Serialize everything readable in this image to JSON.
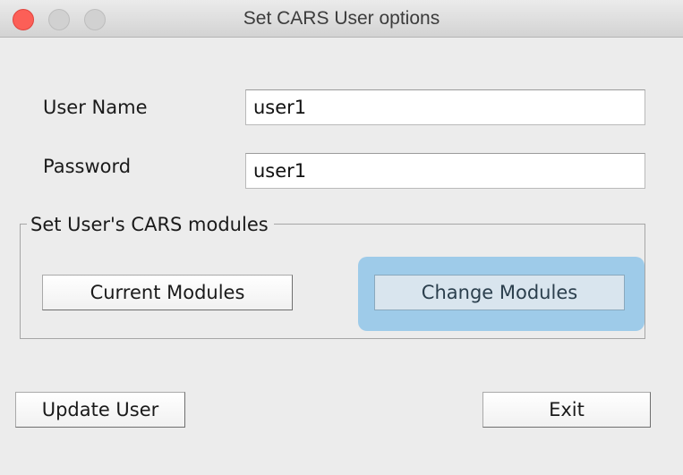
{
  "window": {
    "title": "Set CARS User options"
  },
  "form": {
    "username_label": "User Name",
    "username_value": "user1",
    "password_label": "Password",
    "password_value": "user1"
  },
  "modules_group": {
    "legend": "Set User's CARS  modules",
    "current_label": "Current Modules",
    "change_label": "Change Modules"
  },
  "footer": {
    "update_label": "Update User",
    "exit_label": "Exit"
  },
  "colors": {
    "close": "#fc5f57",
    "focus_ring": "#9ecbe9",
    "window_bg": "#ececec"
  },
  "icons": [
    "close-window-icon",
    "minimize-window-icon",
    "zoom-window-icon"
  ]
}
